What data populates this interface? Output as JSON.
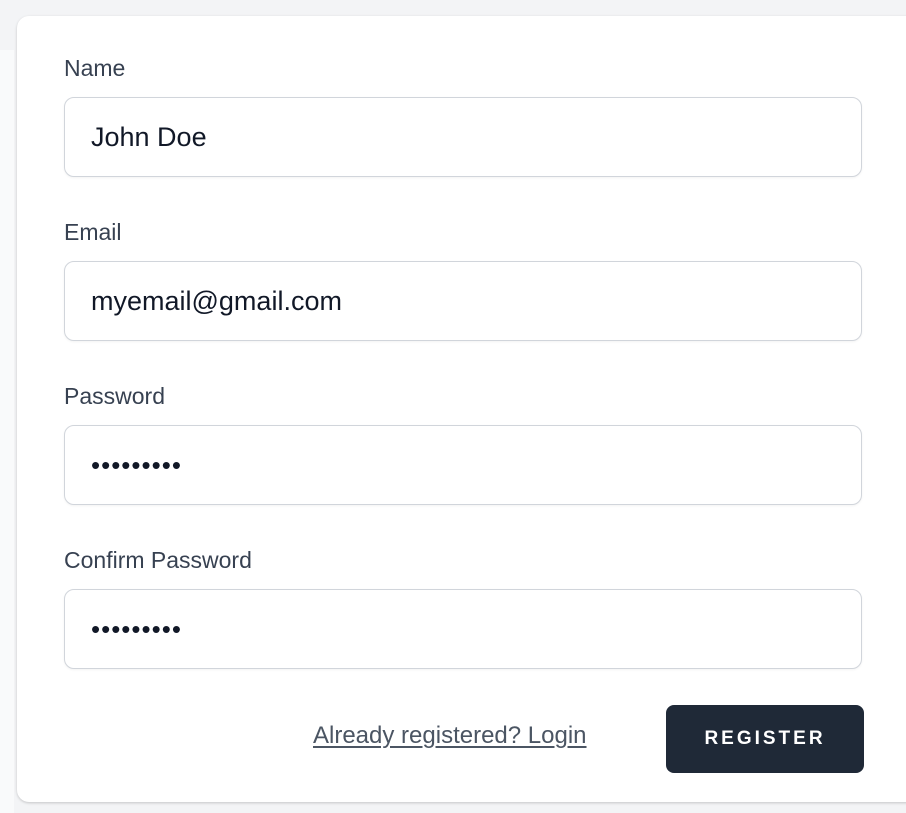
{
  "form": {
    "fields": [
      {
        "label": "Name",
        "value": "John Doe",
        "type": "text"
      },
      {
        "label": "Email",
        "value": "myemail@gmail.com",
        "type": "email"
      },
      {
        "label": "Password",
        "value": "secret123",
        "type": "password"
      },
      {
        "label": "Confirm Password",
        "value": "secret123",
        "type": "password"
      }
    ],
    "login_link": "Already registered? Login",
    "register_button": "REGISTER"
  }
}
